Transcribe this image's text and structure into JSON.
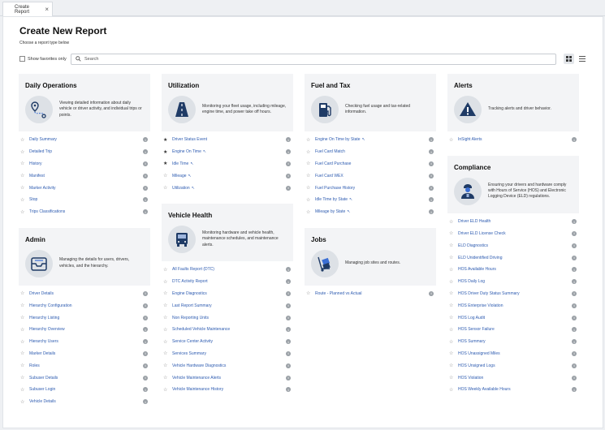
{
  "tab": {
    "label": "Create Report",
    "close": "×"
  },
  "header": {
    "title": "Create New Report",
    "subtitle": "Choose a report type below"
  },
  "toolbar": {
    "favorites_label": "Show favorites only",
    "search_placeholder": "Search"
  },
  "cards": {
    "daily": {
      "title": "Daily Operations",
      "description": "Viewing detailed information about daily vehicle or driver activity, and individual trips or points.",
      "items": [
        {
          "label": "Daily Summary",
          "fav": false,
          "beta": false
        },
        {
          "label": "Detailed Trip",
          "fav": false,
          "beta": false
        },
        {
          "label": "History",
          "fav": false,
          "beta": false
        },
        {
          "label": "Manifest",
          "fav": false,
          "beta": false
        },
        {
          "label": "Marker Activity",
          "fav": false,
          "beta": false
        },
        {
          "label": "Stop",
          "fav": false,
          "beta": false
        },
        {
          "label": "Trips Classifications",
          "fav": false,
          "beta": false
        }
      ]
    },
    "admin": {
      "title": "Admin",
      "description": "Managing the details for users, drivers, vehicles, and the hierarchy.",
      "items": [
        {
          "label": "Driver Details",
          "fav": false,
          "beta": false
        },
        {
          "label": "Hierarchy Configuration",
          "fav": false,
          "beta": false
        },
        {
          "label": "Hierarchy Listing",
          "fav": false,
          "beta": false
        },
        {
          "label": "Hierarchy Overview",
          "fav": false,
          "beta": false
        },
        {
          "label": "Hierarchy Users",
          "fav": false,
          "beta": false
        },
        {
          "label": "Marker Details",
          "fav": false,
          "beta": false
        },
        {
          "label": "Roles",
          "fav": false,
          "beta": false
        },
        {
          "label": "Subuser Details",
          "fav": false,
          "beta": false
        },
        {
          "label": "Subuser Login",
          "fav": false,
          "beta": false
        },
        {
          "label": "Vehicle Details",
          "fav": false,
          "beta": false
        }
      ]
    },
    "utilization": {
      "title": "Utilization",
      "description": "Monitoring your fleet usage, including mileage, engine time, and power take off hours.",
      "items": [
        {
          "label": "Driver Status Event",
          "fav": true,
          "beta": false
        },
        {
          "label": "Engine On Time",
          "fav": true,
          "beta": true
        },
        {
          "label": "Idle Time",
          "fav": true,
          "beta": true
        },
        {
          "label": "Mileage",
          "fav": false,
          "beta": true
        },
        {
          "label": "Utilization",
          "fav": false,
          "beta": true
        }
      ]
    },
    "vehicle_health": {
      "title": "Vehicle Health",
      "description": "Monitoring hardware and vehicle health, maintenance schedules, and maintenance alerts.",
      "items": [
        {
          "label": "All Faults Report (DTC)",
          "fav": false,
          "beta": false
        },
        {
          "label": "DTC Activity Report",
          "fav": false,
          "beta": false
        },
        {
          "label": "Engine Diagnostics",
          "fav": false,
          "beta": false
        },
        {
          "label": "Last Report Summary",
          "fav": false,
          "beta": false
        },
        {
          "label": "Non Reporting Units",
          "fav": false,
          "beta": false
        },
        {
          "label": "Scheduled Vehicle Maintenance",
          "fav": false,
          "beta": false
        },
        {
          "label": "Service Center Activity",
          "fav": false,
          "beta": false
        },
        {
          "label": "Services Summary",
          "fav": false,
          "beta": false
        },
        {
          "label": "Vehicle Hardware Diagnostics",
          "fav": false,
          "beta": false
        },
        {
          "label": "Vehicle Maintenance Alerts",
          "fav": false,
          "beta": false
        },
        {
          "label": "Vehicle Maintenance History",
          "fav": false,
          "beta": false
        }
      ]
    },
    "fuel": {
      "title": "Fuel and Tax",
      "description": "Checking fuel usage and tax-related information.",
      "items": [
        {
          "label": "Engine On Time by State",
          "fav": false,
          "beta": true
        },
        {
          "label": "Fuel Card Match",
          "fav": false,
          "beta": false
        },
        {
          "label": "Fuel Card Purchase",
          "fav": false,
          "beta": false
        },
        {
          "label": "Fuel Card WEX",
          "fav": false,
          "beta": false
        },
        {
          "label": "Fuel Purchase History",
          "fav": false,
          "beta": false
        },
        {
          "label": "Idle Time by State",
          "fav": false,
          "beta": true
        },
        {
          "label": "Mileage by State",
          "fav": false,
          "beta": true
        }
      ]
    },
    "jobs": {
      "title": "Jobs",
      "description": "Managing job sites and routes.",
      "items": [
        {
          "label": "Route - Planned vs Actual",
          "fav": false,
          "beta": false
        }
      ]
    },
    "alerts": {
      "title": "Alerts",
      "description": "Tracking alerts and driver behavior.",
      "items": [
        {
          "label": "InSight Alerts",
          "fav": false,
          "beta": false
        }
      ]
    },
    "compliance": {
      "title": "Compliance",
      "description": "Ensuring your drivers and hardware comply with Hours of Service (HOS) and Electronic Logging Device (ELD) regulations.",
      "items": [
        {
          "label": "Driver ELD Health",
          "fav": false,
          "beta": false
        },
        {
          "label": "Driver ELD License Check",
          "fav": false,
          "beta": false
        },
        {
          "label": "ELD Diagnostics",
          "fav": false,
          "beta": false
        },
        {
          "label": "ELD Unidentified Driving",
          "fav": false,
          "beta": false
        },
        {
          "label": "HOS Available Hours",
          "fav": false,
          "beta": false
        },
        {
          "label": "HOS Daily Log",
          "fav": false,
          "beta": false
        },
        {
          "label": "HOS Driver Duty Status Summary",
          "fav": false,
          "beta": false
        },
        {
          "label": "HOS Enterprise Violation",
          "fav": false,
          "beta": false
        },
        {
          "label": "HOS Log Audit",
          "fav": false,
          "beta": false
        },
        {
          "label": "HOS Sensor Failure",
          "fav": false,
          "beta": false
        },
        {
          "label": "HOS Summary",
          "fav": false,
          "beta": false
        },
        {
          "label": "HOS Unassigned Miles",
          "fav": false,
          "beta": false
        },
        {
          "label": "HOS Unsigned Logs",
          "fav": false,
          "beta": false
        },
        {
          "label": "HOS Violation",
          "fav": false,
          "beta": false
        },
        {
          "label": "HOS Weekly Available Hours",
          "fav": false,
          "beta": false
        }
      ]
    }
  },
  "icons": {
    "star_empty": "☆",
    "star_filled": "★",
    "beta_mark": "↖",
    "info": "i",
    "daily": "map-pin-route-icon",
    "admin": "inbox-tray-icon",
    "utilization": "road-icon",
    "vehicle_health": "truck-front-icon",
    "fuel": "fuel-pump-icon",
    "jobs": "hand-truck-boxes-icon",
    "alerts": "warning-triangle-icon",
    "compliance": "driver-icon"
  },
  "colors": {
    "link": "#2d5bb0",
    "icon_navy": "#1f3b66",
    "accent_blue": "#3b6fd4"
  }
}
